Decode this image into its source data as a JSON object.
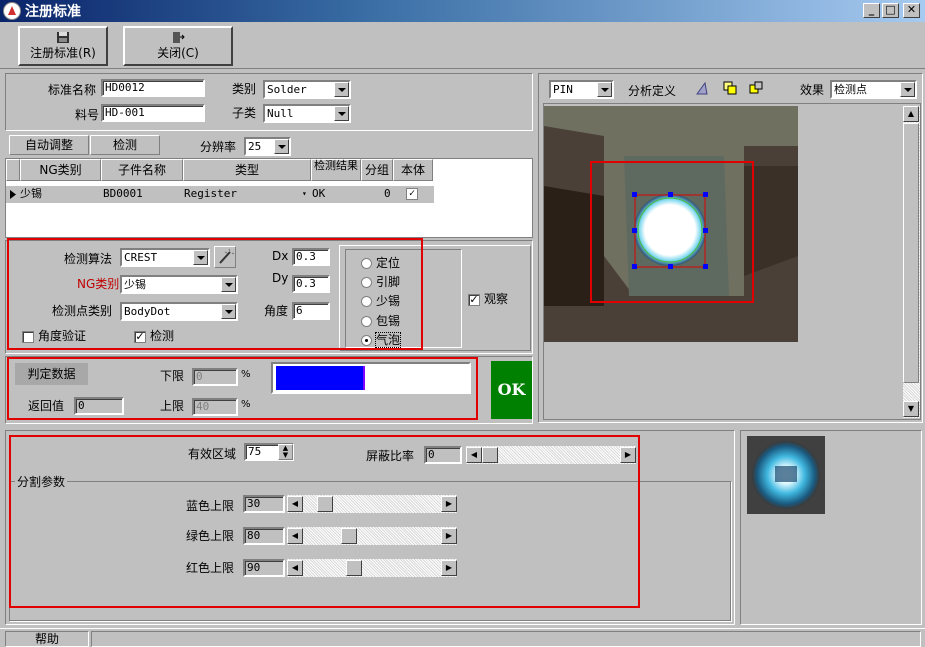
{
  "window": {
    "title": "注册标准",
    "min": "_",
    "max": "□",
    "close": "✕"
  },
  "toolbar": {
    "register_label": "注册标准(R)",
    "close_label": "关闭(C)"
  },
  "standard": {
    "name_label": "标准名称",
    "name_value": "HD0012",
    "part_label": "料号",
    "part_value": "HD-001",
    "category_label": "类别",
    "category_value": "Solder",
    "subcategory_label": "子类",
    "subcategory_value": "Null"
  },
  "controls": {
    "auto_adjust": "自动调整",
    "detect": "检测",
    "resolution_label": "分辨率",
    "resolution_value": "25"
  },
  "table": {
    "headers": [
      "NG类别",
      "子件名称",
      "类型",
      "检测结果",
      "分组",
      "本体"
    ],
    "rows": [
      {
        "ng": "少锡",
        "name": "BD0001",
        "type": "Register",
        "result": "OK",
        "group": "0",
        "body": "✓"
      }
    ]
  },
  "algo": {
    "algo_label": "检测算法",
    "algo_value": "CREST",
    "ng_label": "NG类别",
    "ng_value": "少锡",
    "point_label": "检测点类别",
    "point_value": "BodyDot",
    "dx_label": "Dx",
    "dx_value": "0.3",
    "dy_label": "Dy",
    "dy_value": "0.3",
    "angle_label": "角度",
    "angle_value": "6",
    "angle_verify_label": "角度验证",
    "detect_label": "检测",
    "ng_color": "#c00000"
  },
  "radios": [
    "定位",
    "引脚",
    "少锡",
    "包锡",
    "气泡"
  ],
  "observe_label": "观察",
  "judge": {
    "tab_label": "判定数据",
    "lower_label": "下限",
    "lower_value": "0",
    "upper_label": "上限",
    "upper_value": "40",
    "pct": "%",
    "return_label": "返回值",
    "return_value": "0",
    "result": "OK",
    "bar_fraction": 0.47,
    "bar_color": "#0000ff",
    "ok_color": "#008000"
  },
  "view": {
    "pin_value": "PIN",
    "analysis_label": "分析定义",
    "effect_label": "效果",
    "effect_value": "检测点"
  },
  "region": {
    "valid_label": "有效区域",
    "valid_value": "75",
    "mask_label": "屏蔽比率",
    "mask_value": "0",
    "mask_fraction": 0,
    "segment_title": "分割参数",
    "blue_label": "蓝色上限",
    "blue_value": "30",
    "blue_fraction": 0.118,
    "green_label": "绿色上限",
    "green_value": "80",
    "green_fraction": 0.314,
    "red_label": "红色上限",
    "red_value": "90",
    "red_fraction": 0.353
  },
  "status": {
    "help": "帮助"
  }
}
